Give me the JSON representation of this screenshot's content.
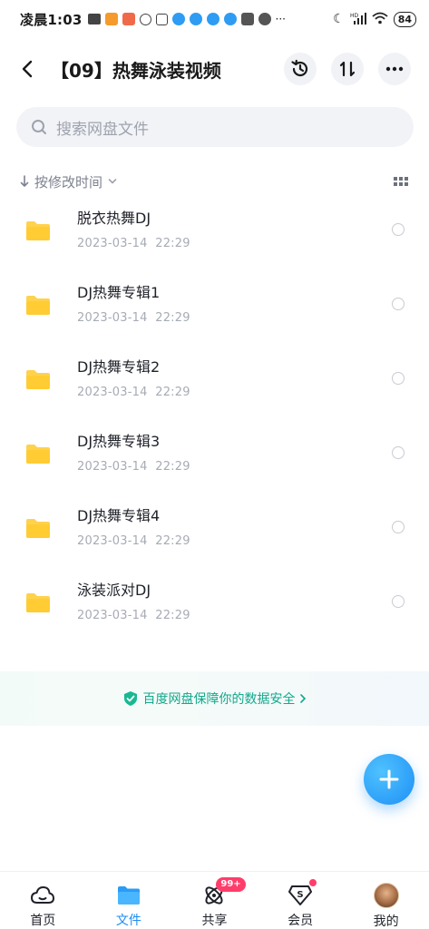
{
  "status_bar": {
    "time": "凌晨1:03",
    "battery": "84",
    "network": "HD"
  },
  "header": {
    "title": "【09】热舞泳装视频"
  },
  "search": {
    "placeholder": "搜索网盘文件"
  },
  "sort": {
    "label": "按修改时间"
  },
  "files": [
    {
      "name": "脱衣热舞DJ",
      "date": "2023-03-14",
      "time": "22:29"
    },
    {
      "name": "DJ热舞专辑1",
      "date": "2023-03-14",
      "time": "22:29"
    },
    {
      "name": "DJ热舞专辑2",
      "date": "2023-03-14",
      "time": "22:29"
    },
    {
      "name": "DJ热舞专辑3",
      "date": "2023-03-14",
      "time": "22:29"
    },
    {
      "name": "DJ热舞专辑4",
      "date": "2023-03-14",
      "time": "22:29"
    },
    {
      "name": "泳装派对DJ",
      "date": "2023-03-14",
      "time": "22:29"
    }
  ],
  "safety_banner": {
    "text": "百度网盘保障你的数据安全"
  },
  "tabs": [
    {
      "label": "首页",
      "icon": "cloud-icon"
    },
    {
      "label": "文件",
      "icon": "folder-icon",
      "active": true
    },
    {
      "label": "共享",
      "icon": "share-icon",
      "badge": "99+"
    },
    {
      "label": "会员",
      "icon": "vip-icon",
      "dot": true
    },
    {
      "label": "我的",
      "icon": "avatar-icon"
    }
  ],
  "colors": {
    "accent": "#1d8cf4",
    "folder": "#ffd24d",
    "safe_green": "#11a98c",
    "badge": "#ff3d6a"
  }
}
